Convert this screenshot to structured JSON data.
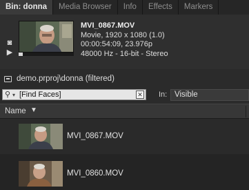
{
  "tabs": [
    {
      "label": "Bin: donna",
      "active": true
    },
    {
      "label": "Media Browser",
      "active": false
    },
    {
      "label": "Info",
      "active": false
    },
    {
      "label": "Effects",
      "active": false
    },
    {
      "label": "Markers",
      "active": false
    }
  ],
  "preview": {
    "filename": "MVI_0867.MOV",
    "line1": "Movie, 1920 x 1080 (1.0)",
    "line2": "00:00:54:09, 23.976p",
    "line3": "48000 Hz - 16-bit - Stereo",
    "icons": [
      "camera-icon",
      "play-icon"
    ],
    "play_glyph": "▶",
    "camera_glyph": "◙"
  },
  "project": {
    "path": "demo.prproj\\donna (filtered)"
  },
  "search": {
    "value": "[Find Faces]",
    "mag_glyph": "⚲",
    "dropdown_glyph": "▾",
    "clear_glyph": "✕",
    "in_label": "In:",
    "in_value": "Visible"
  },
  "list": {
    "column_name": "Name",
    "sort_glyph": "▼",
    "items": [
      {
        "name": "MVI_0867.MOV"
      },
      {
        "name": "MVI_0860.MOV"
      }
    ]
  },
  "colors": {
    "background": "#2b2b2b",
    "tab_active": "#3a3a3a",
    "search_field": "#e6e6e6"
  }
}
